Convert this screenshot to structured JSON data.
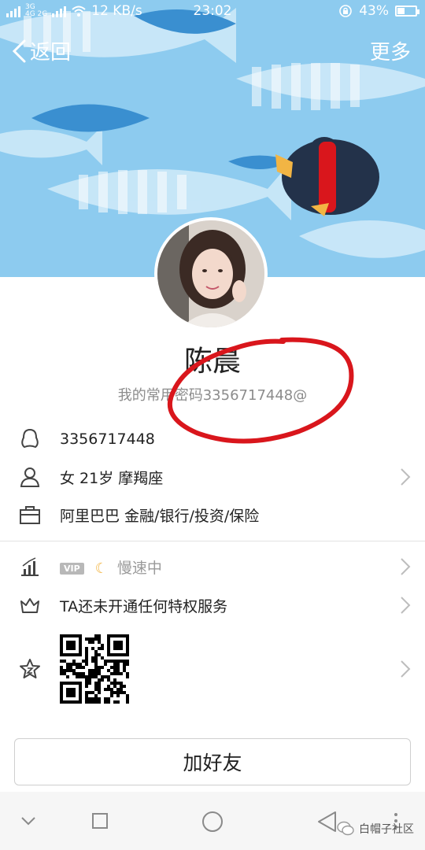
{
  "status_bar": {
    "network_top": "3G",
    "network_bottom": "4G 2G",
    "speed": "12 KB/s",
    "time": "23:02",
    "battery": "43%",
    "battery_level": 0.43
  },
  "nav": {
    "back_label": "返回",
    "more_label": "更多"
  },
  "profile": {
    "name": "陈晨",
    "signature": "我的常用密码3356717448@"
  },
  "info": {
    "qq_number": "3356717448",
    "personal": "女  21岁  摩羯座",
    "company": "阿里巴巴 金融/银行/投资/保险"
  },
  "services": {
    "vip_badge": "VIP",
    "speed_status": "慢速中",
    "privilege": "TA还未开通任何特权服务"
  },
  "actions": {
    "add_friend": "加好友"
  },
  "watermark": "白帽子社区",
  "colors": {
    "banner_blue": "#7fc3ea",
    "annotation_red": "#d9161c",
    "penguin_navy": "#23324a"
  }
}
